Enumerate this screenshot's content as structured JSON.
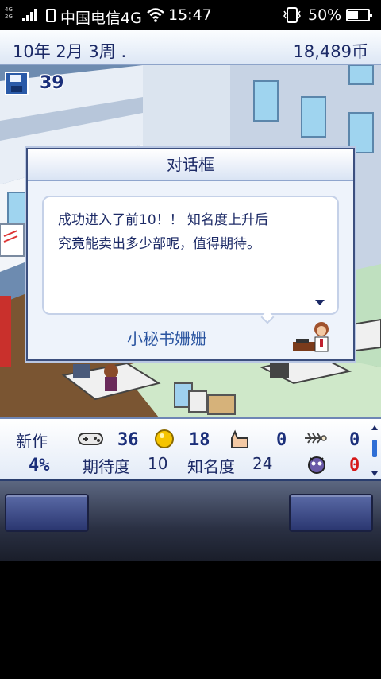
{
  "status_bar": {
    "network_small": [
      "4G",
      "2G"
    ],
    "carrier": "中国电信4G",
    "time": "15:47",
    "battery": "50%",
    "battery_level": 0.5,
    "icons": [
      "signal-icon",
      "sim-icon",
      "wifi-icon",
      "vibrate-icon",
      "battery-icon"
    ]
  },
  "top_bar": {
    "date": "10年 2月 3周 .",
    "money": "18,489币"
  },
  "scene": {
    "save_count": "39"
  },
  "dialog": {
    "title": "对话框",
    "message_line1": "成功进入了前10！！ 知名度上升后",
    "message_line2": "究竟能卖出多少部呢，值得期待。",
    "speaker": "小秘书姗姗"
  },
  "stats": {
    "label_new": "新作",
    "gamepad_value": "36",
    "coin_value": "18",
    "hand_value": "0",
    "fish_value": "0",
    "percent": "4%",
    "expect_label": "期待度",
    "expect_value": "10",
    "fame_label": "知名度",
    "fame_value": "24",
    "bug_value": "0"
  },
  "colors": {
    "text_dark": "#1c2a66",
    "accent_blue": "#2a54a0",
    "alert_red": "#d61a1a"
  }
}
